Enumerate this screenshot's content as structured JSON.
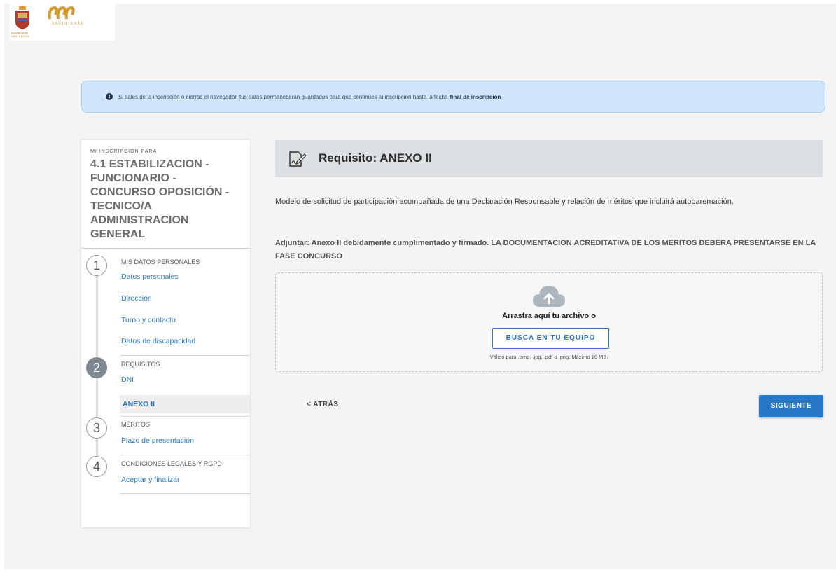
{
  "brand": {
    "shield_caption": "Ayuntamiento SANTA LUCÍA",
    "town_logo_text": "SANTA LUCÍA"
  },
  "banner": {
    "icon": "info-icon",
    "text": "Si sales de la inscripción o cierras el navegador, tus datos permanecerán guardados para que continúes tu inscripción hasta la fecha",
    "emphasis": "final de inscripción"
  },
  "sidebar": {
    "kicker": "MI INSCRIPCIÓN PARA",
    "title": "4.1 ESTABILIZACION - FUNCIONARIO - CONCURSO OPOSICIÓN - TECNICO/A ADMINISTRACION GENERAL",
    "steps": [
      {
        "number": "1",
        "heading": "MIS DATOS PERSONALES",
        "items": [
          "Datos personales",
          "Dirección",
          "Turno y contacto",
          "Datos de discapacidad"
        ]
      },
      {
        "number": "2",
        "heading": "REQUISITOS",
        "items": [
          "DNI",
          "ANEXO II"
        ]
      },
      {
        "number": "3",
        "heading": "MÉRITOS",
        "items": [
          "Plazo de presentación"
        ]
      },
      {
        "number": "4",
        "heading": "CONDICIONES LEGALES Y RGPD",
        "items": [
          "Aceptar y finalizar"
        ]
      }
    ]
  },
  "requirement": {
    "icon": "signature-document-icon",
    "title": "Requisito: ANEXO II",
    "description": "Modelo de solicitud de participación acompañada de una Declaración Responsable y relación de méritos que incluirá autobaremación.",
    "attach_note": "Adjuntar: Anexo II debidamente cumplimentado y firmado. LA DOCUMENTACION ACREDITATIVA DE LOS MERITOS DEBERA PRESENTARSE EN LA FASE CONCURSO"
  },
  "upload": {
    "icon": "cloud-upload-icon",
    "drag_text": "Arrastra aquí tu archivo o",
    "browse_label": "BUSCA EN TU EQUIPO",
    "hint": "Válido para .bmp, .jpg, .pdf o .png. Máximo 10 MB."
  },
  "nav": {
    "back_label": "< ATRÁS",
    "next_label": "SIGUIENTE"
  },
  "colors": {
    "accent": "#2878c8",
    "banner_bg": "#cfe5fb",
    "header_bg": "#dde0e3"
  }
}
